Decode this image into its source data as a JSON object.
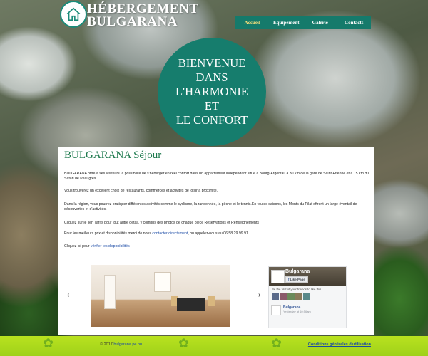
{
  "header": {
    "title_line1": "HÉBERGEMENT",
    "title_line2": "BULGARANA",
    "logo_icon": "house-icon"
  },
  "nav": {
    "items": [
      {
        "label": "Accueil",
        "active": true
      },
      {
        "label": "Equipement",
        "active": false
      },
      {
        "label": "Galerie",
        "active": false
      },
      {
        "label": "Contacts",
        "active": false
      }
    ]
  },
  "hero": {
    "lines": [
      "BIENVENUE",
      "DANS",
      "L'HARMONIE",
      "ET",
      "LE CONFORT"
    ]
  },
  "content": {
    "heading": "BULGARANA Séjour",
    "p1": "BULGARANA offre à ses visiteurs la possibilité de s'héberger en réel confort dans un appartement indépendant situé à Bourg-Argental, à 30 km de la gare de Saint-Etienne et à 15 km du Safari de Peaugres.",
    "p2": "Vous trouverez un excellent choix de restaurants, commerces et activités de loisir à proximité.",
    "p3": "Dans la région, vous pourrez pratiquer différentes activités comme le cyclisme, la randonnée, la pêche et le tennis.En toutes saisons, les Monts du Pilat offrent un large éventail de découvertes et d'activités.",
    "p4": "Cliquez sur le lien Tarifs pour tout autre détail, y compris des photos de chaque pièce Réservations et Renseignements",
    "p5_prefix": "Pour les meilleurs prix et disponibilités merci de nous",
    "p5_link": "contacter directement",
    "p5_suffix": ", ou appelez-nous au  06 58 29 99 91",
    "p6_prefix": "Cliquez ici pour",
    "p6_link": "vérifier les disponibilités"
  },
  "slider": {
    "prev_label": "‹",
    "next_label": "›"
  },
  "facebook": {
    "page_name": "Bulgarana",
    "like_button": "Like Page",
    "friends_text": "Be the first of your friends to like this",
    "post_name": "Bulgarana",
    "post_time": "Yesterday at 10:56am"
  },
  "footer": {
    "copyright": "© 2017",
    "site_link": "bulgarana.pe.hu",
    "legal_link": "Conditions générales d'utilisation"
  },
  "colors": {
    "accent": "#157a6b",
    "heading": "#1e7a4e",
    "footer": "#b9e21f"
  }
}
